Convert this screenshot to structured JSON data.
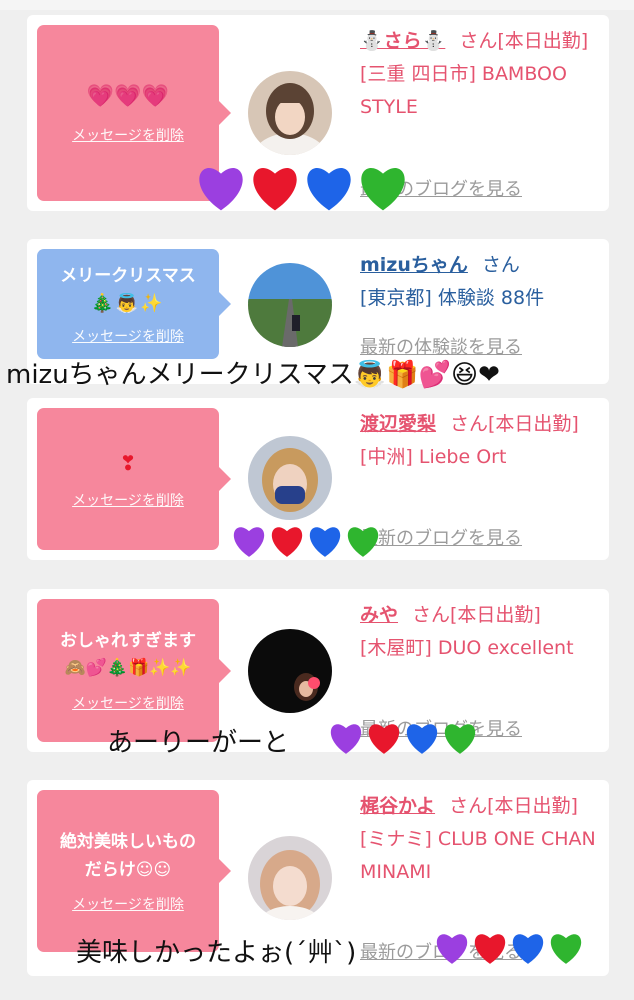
{
  "cards": [
    {
      "message": "💗💗💗",
      "delete_label": "メッセージを削除",
      "name": "⛄さら⛄",
      "san": "さん[本日出勤]",
      "area": "[三重 四日市] BAMBOO STYLE",
      "link": "最新のブログを見る"
    },
    {
      "message_line1": "メリークリスマス",
      "message_line2": "🎄👼✨",
      "delete_label": "メッセージを削除",
      "name": "mizuちゃん",
      "san": "さん",
      "area": "[東京都] 体験談 88件",
      "link": "最新の体験談を見る"
    },
    {
      "message": "❣",
      "delete_label": "メッセージを削除",
      "name": "渡辺愛梨",
      "san": "さん[本日出勤]",
      "area": "[中洲] Liebe Ort",
      "link": "最新のブログを見る"
    },
    {
      "message_line1": "おしゃれすぎます",
      "message_line2": "🙈💕🎄🎁✨✨",
      "delete_label": "メッセージを削除",
      "name": "みや",
      "san": "さん[本日出勤]",
      "area": "[木屋町] DUO excellent",
      "link": "最新のブログを見る"
    },
    {
      "message_line1": "絶対美味しいもの",
      "message_line2": "だらけ☺☺",
      "delete_label": "メッセージを削除",
      "name": "梶谷かよ",
      "san": "さん[本日出勤]",
      "area": "[ミナミ] CLUB ONE CHAN MINAMI",
      "link": "最新のブログを見る"
    }
  ],
  "overlays": {
    "caption_2": "mizuちゃんメリークリスマス👼🎁💕😆❤",
    "caption_4": "あーりーがーと",
    "caption_5": "美味しかったよぉ(´艸`)"
  },
  "colors": {
    "pink_bubble": "#f6879c",
    "blue_bubble": "#8fb6ee",
    "name_pink": "#e5536f",
    "name_blue": "#2a5f9e",
    "heart_purple": "#9b3fe0",
    "heart_red": "#e8172c",
    "heart_blue": "#1e64e8",
    "heart_green": "#2fb52f"
  }
}
